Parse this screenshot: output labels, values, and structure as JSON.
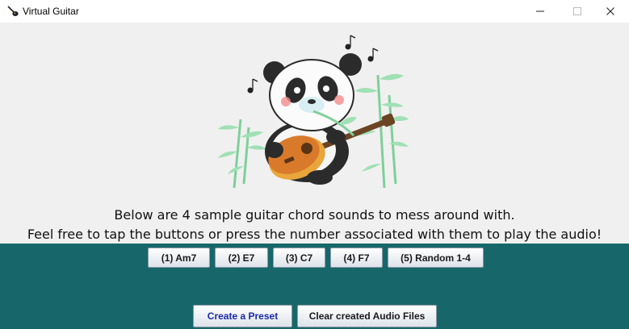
{
  "window": {
    "title": "Virtual Guitar",
    "controls": [
      "minimize-icon",
      "maximize-icon",
      "close-icon"
    ]
  },
  "description": {
    "line1": "Below are 4 sample guitar chord sounds to mess around with.",
    "line2": "Feel free to tap the buttons or press the number associated with them to play the audio!"
  },
  "chord_buttons": [
    {
      "label": "(1) Am7"
    },
    {
      "label": "(2) E7"
    },
    {
      "label": "(3) C7"
    },
    {
      "label": "(4) F7"
    },
    {
      "label": "(5) Random 1-4"
    }
  ],
  "actions": {
    "create_preset": "Create a Preset",
    "clear_audio": "Clear created Audio Files"
  },
  "colors": {
    "panel": "#17676a",
    "window_bg": "#f0f0f0",
    "preset_text": "#1a2aa8"
  }
}
